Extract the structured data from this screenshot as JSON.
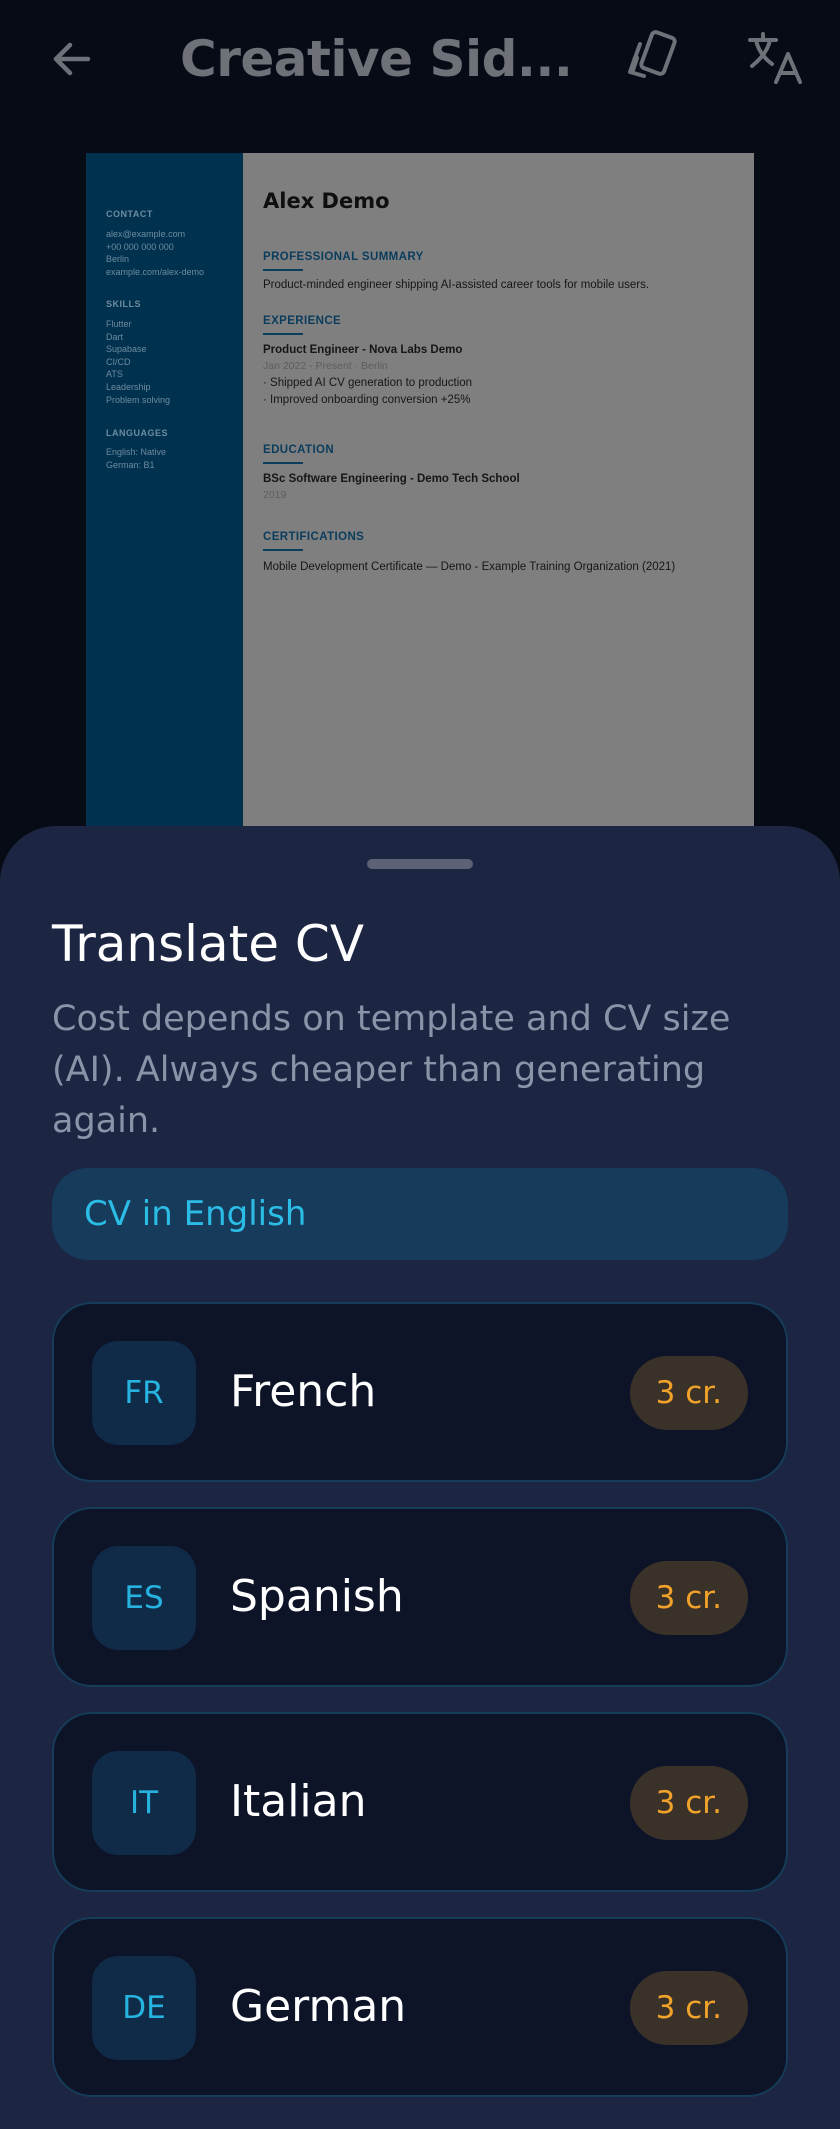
{
  "appbar": {
    "title": "Creative Sid...",
    "back_icon": "arrow-left-icon",
    "template_icon": "cards-icon",
    "translate_icon": "translate-icon"
  },
  "cv_preview": {
    "name": "Alex Demo",
    "sidebar": {
      "contact_heading": "CONTACT",
      "contact_lines": "alex@example.com\n+00 000 000 000\nBerlin\nexample.com/alex-demo",
      "skills_heading": "SKILLS",
      "skills_lines": "Flutter\nDart\nSupabase\nCI/CD\nATS\nLeadership\nProblem solving",
      "languages_heading": "LANGUAGES",
      "languages_lines": "English: Native\nGerman: B1"
    },
    "summary_heading": "PROFESSIONAL SUMMARY",
    "summary_text": "Product-minded engineer shipping AI-assisted career tools for mobile users.",
    "experience_heading": "EXPERIENCE",
    "job_title": "Product Engineer - Nova Labs Demo",
    "job_meta": "Jan 2022 - Present · Berlin",
    "job_bullet_1": "· Shipped AI CV generation to production",
    "job_bullet_2": "· Improved onboarding conversion +25%",
    "education_heading": "EDUCATION",
    "degree": "BSc Software Engineering - Demo Tech School",
    "degree_year": "2019",
    "certifications_heading": "CERTIFICATIONS",
    "certification": "Mobile Development Certificate — Demo - Example Training Organization (2021)"
  },
  "sheet": {
    "title": "Translate CV",
    "description": "Cost depends on template and CV size (AI). Always cheaper than generating again.",
    "current_language": "CV in English",
    "languages": [
      {
        "code": "FR",
        "name": "French",
        "cost": "3 cr."
      },
      {
        "code": "ES",
        "name": "Spanish",
        "cost": "3 cr."
      },
      {
        "code": "IT",
        "name": "Italian",
        "cost": "3 cr."
      },
      {
        "code": "DE",
        "name": "German",
        "cost": "3 cr."
      }
    ]
  },
  "colors": {
    "background": "#070b16",
    "sheet": "#1c2541",
    "accent": "#27b3df",
    "cost_text": "#f1a22a"
  }
}
